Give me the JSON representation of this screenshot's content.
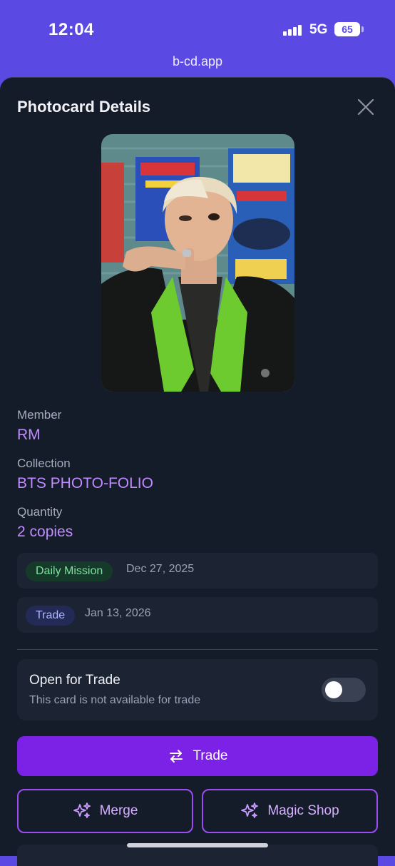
{
  "status": {
    "time": "12:04",
    "network": "5G",
    "battery": "65"
  },
  "browser": {
    "url": "b-cd.app"
  },
  "modal": {
    "title": "Photocard Details",
    "member_label": "Member",
    "member_value": "RM",
    "collection_label": "Collection",
    "collection_value": "BTS PHOTO-FOLIO",
    "quantity_label": "Quantity",
    "quantity_value": "2 copies",
    "history": [
      {
        "badge": "Daily Mission",
        "date": "Dec 27, 2025"
      },
      {
        "badge": "Trade",
        "date": "Jan 13, 2026"
      }
    ],
    "trade_setting": {
      "title": "Open for Trade",
      "subtitle": "This card is not available for trade",
      "enabled": false
    },
    "buttons": {
      "trade": "Trade",
      "merge": "Merge",
      "magic_shop": "Magic Shop"
    }
  },
  "colors": {
    "status_bar": "#5a4ae3",
    "sheet_bg": "#141b29",
    "accent": "#7b22e6",
    "value_text": "#c08bff"
  }
}
